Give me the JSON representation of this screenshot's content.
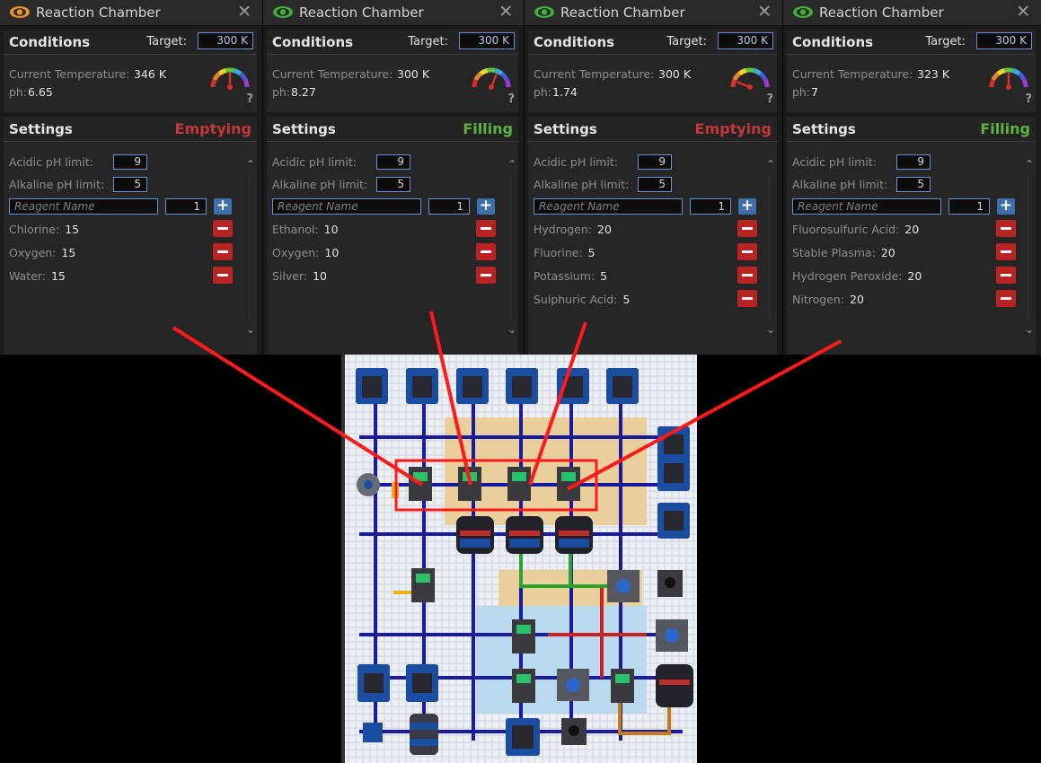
{
  "colors": {
    "emptying": "#c23838",
    "filling": "#5cb43c",
    "eye_orange": "#e8952a",
    "eye_green": "#3fae3a",
    "annotation_red": "#ff1a1a"
  },
  "panels": [
    {
      "title": "Reaction Chamber",
      "eye_color": "orange",
      "conditions_label": "Conditions",
      "target_label": "Target:",
      "target_value": "300 K",
      "temp_label": "Current Temperature:",
      "temp_value": "346 K",
      "ph_label": "ph:",
      "ph_value": "6.65",
      "gauge_level": 0.5,
      "settings_label": "Settings",
      "status": "Emptying",
      "acidic_label": "Acidic pH limit:",
      "acidic_value": "9",
      "alkaline_label": "Alkaline pH limit:",
      "alkaline_value": "5",
      "reagent_placeholder": "Reagent Name",
      "amount_value": "1",
      "reagents": [
        {
          "name": "Chlorine:",
          "amount": "15"
        },
        {
          "name": "Oxygen:",
          "amount": "15"
        },
        {
          "name": "Water:",
          "amount": "15"
        }
      ]
    },
    {
      "title": "Reaction Chamber",
      "eye_color": "green",
      "conditions_label": "Conditions",
      "target_label": "Target:",
      "target_value": "300 K",
      "temp_label": "Current Temperature:",
      "temp_value": "300 K",
      "ph_label": "ph:",
      "ph_value": "8.27",
      "gauge_level": 0.62,
      "settings_label": "Settings",
      "status": "Filling",
      "acidic_label": "Acidic pH limit:",
      "acidic_value": "9",
      "alkaline_label": "Alkaline pH limit:",
      "alkaline_value": "5",
      "reagent_placeholder": "Reagent Name",
      "amount_value": "1",
      "reagents": [
        {
          "name": "Ethanol:",
          "amount": "10"
        },
        {
          "name": "Oxygen:",
          "amount": "10"
        },
        {
          "name": "Silver:",
          "amount": "10"
        }
      ]
    },
    {
      "title": "Reaction Chamber",
      "eye_color": "green",
      "conditions_label": "Conditions",
      "target_label": "Target:",
      "target_value": "300 K",
      "temp_label": "Current Temperature:",
      "temp_value": "300 K",
      "ph_label": "ph:",
      "ph_value": "1.74",
      "gauge_level": 0.12,
      "settings_label": "Settings",
      "status": "Emptying",
      "acidic_label": "Acidic pH limit:",
      "acidic_value": "9",
      "alkaline_label": "Alkaline pH limit:",
      "alkaline_value": "5",
      "reagent_placeholder": "Reagent Name",
      "amount_value": "1",
      "reagents": [
        {
          "name": "Hydrogen:",
          "amount": "20"
        },
        {
          "name": "Fluorine:",
          "amount": "5"
        },
        {
          "name": "Potassium:",
          "amount": "5"
        },
        {
          "name": "Sulphuric Acid:",
          "amount": "5"
        }
      ]
    },
    {
      "title": "Reaction Chamber",
      "eye_color": "green",
      "conditions_label": "Conditions",
      "target_label": "Target:",
      "target_value": "300 K",
      "temp_label": "Current Temperature:",
      "temp_value": "323 K",
      "ph_label": "ph:",
      "ph_value": "7",
      "gauge_level": 0.5,
      "settings_label": "Settings",
      "status": "Filling",
      "acidic_label": "Acidic pH limit:",
      "acidic_value": "9",
      "alkaline_label": "Alkaline pH limit:",
      "alkaline_value": "5",
      "reagent_placeholder": "Reagent Name",
      "amount_value": "1",
      "reagents": [
        {
          "name": "Fluorosulfuric Acid:",
          "amount": "20"
        },
        {
          "name": "Stable Plasma:",
          "amount": "20"
        },
        {
          "name": "Hydrogen Peroxide:",
          "amount": "20"
        },
        {
          "name": "Nitrogen:",
          "amount": "20"
        }
      ]
    }
  ]
}
